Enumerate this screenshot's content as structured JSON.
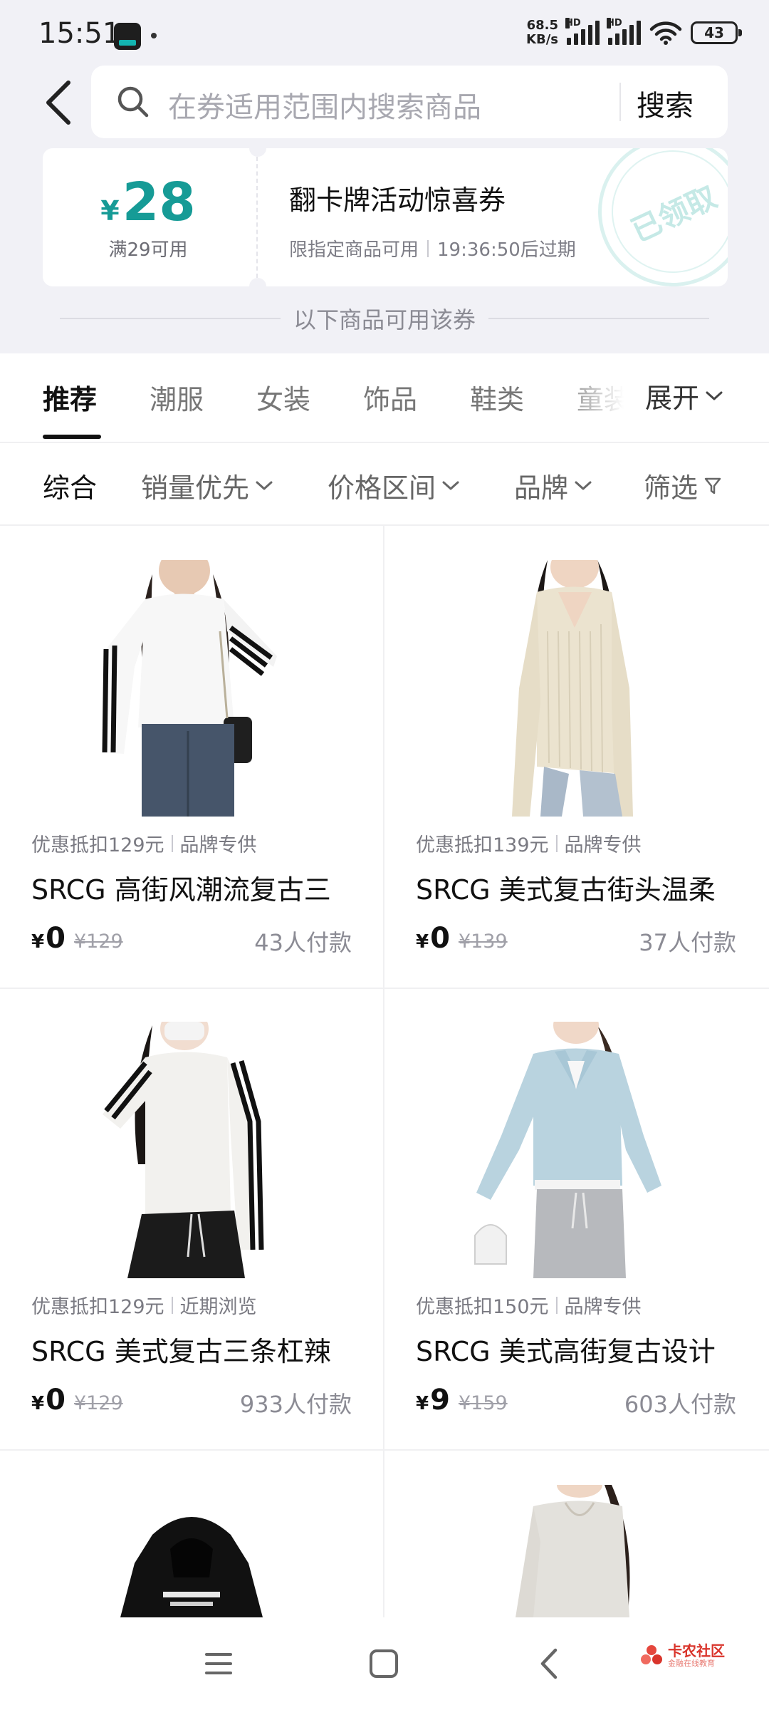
{
  "status_bar": {
    "time": "15:51",
    "net_speed_value": "68.5",
    "net_speed_unit": "KB/s",
    "signal_tag_1": "HD",
    "signal_tag_2": "HD",
    "battery": "43"
  },
  "search": {
    "placeholder": "在券适用范围内搜索商品",
    "button": "搜索"
  },
  "coupon": {
    "currency": "¥",
    "amount": "28",
    "threshold": "满29可用",
    "title": "翻卡牌活动惊喜券",
    "scope": "限指定商品可用",
    "expiry": "19:36:50后过期",
    "stamp": "已领取",
    "accent_color": "#169b96"
  },
  "products_note": "以下商品可用该券",
  "categories": {
    "tabs": [
      "推荐",
      "潮服",
      "女装",
      "饰品",
      "鞋类",
      "童装"
    ],
    "active_index": 0,
    "expand": "展开"
  },
  "filters": {
    "items": [
      "综合",
      "销量优先",
      "价格区间",
      "品牌",
      "筛选"
    ],
    "active_index": 0
  },
  "products": [
    {
      "promo": "优惠抵扣129元",
      "tag": "品牌专供",
      "title": "SRCG 高街风潮流复古三",
      "currency": "¥",
      "price": "0",
      "original_price": "¥129",
      "sales": "43人付款"
    },
    {
      "promo": "优惠抵扣139元",
      "tag": "品牌专供",
      "title": "SRCG 美式复古街头温柔",
      "currency": "¥",
      "price": "0",
      "original_price": "¥139",
      "sales": "37人付款"
    },
    {
      "promo": "优惠抵扣129元",
      "tag": "近期浏览",
      "title": "SRCG 美式复古三条杠辣",
      "currency": "¥",
      "price": "0",
      "original_price": "¥129",
      "sales": "933人付款"
    },
    {
      "promo": "优惠抵扣150元",
      "tag": "品牌专供",
      "title": "SRCG 美式高街复古设计",
      "currency": "¥",
      "price": "9",
      "original_price": "¥159",
      "sales": "603人付款"
    }
  ],
  "watermark": {
    "title": "卡农社区",
    "subtitle": "金融在线教育"
  }
}
